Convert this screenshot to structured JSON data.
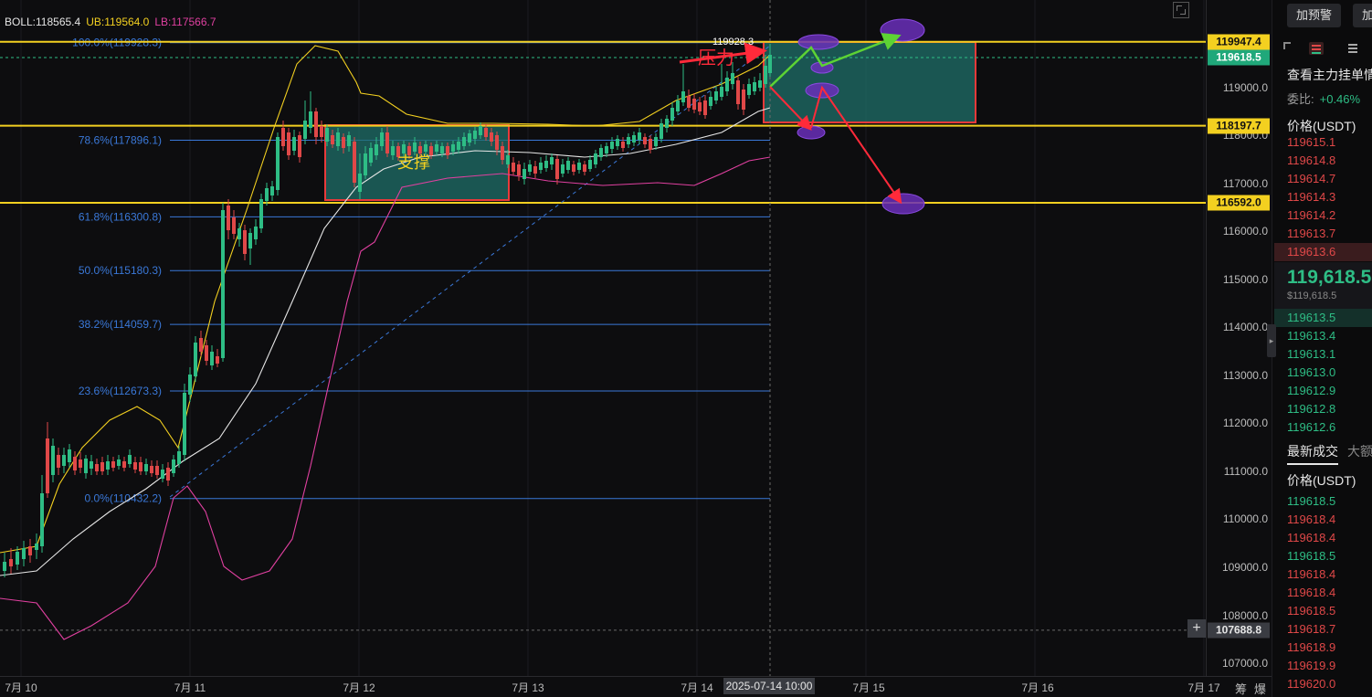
{
  "chart": {
    "boll": {
      "main_label": "BOLL:118565.4",
      "ub_label": "UB:119564.0",
      "lb_label": "LB:117566.7",
      "main_color": "#e6e6e6",
      "ub_color": "#f3d020",
      "lb_color": "#e040a0"
    },
    "fib_levels": [
      {
        "label": "100.0%(119928.3)",
        "price": 119928.3
      },
      {
        "label": "78.6%(117896.1)",
        "price": 117896.1
      },
      {
        "label": "61.8%(116300.8)",
        "price": 116300.8
      },
      {
        "label": "50.0%(115180.3)",
        "price": 115180.3
      },
      {
        "label": "38.2%(114059.7)",
        "price": 114059.7
      },
      {
        "label": "23.6%(112673.3)",
        "price": 112673.3
      },
      {
        "label": "0.0%(110432.2)",
        "price": 110432.2
      }
    ],
    "horizontal_levels": [
      119947.4,
      118197.7,
      116592.0
    ],
    "current_price_line": 119618.5,
    "crosshair_price": 107688.8,
    "high_marker": "119928.3",
    "support_label": "支撑",
    "pressure_label": "压力",
    "colors": {
      "up": "#2ebd85",
      "down": "#e04848",
      "fib": "#3a78d8",
      "level": "#f3d020",
      "zone_fill": "#1f6f6a",
      "zone_border": "#e83a3a",
      "arrow_red": "#ff2a3a",
      "arrow_green": "#5dd334",
      "ellipse": "#6a2fb8"
    }
  },
  "price_axis": {
    "ticks": [
      "119000.0",
      "118000.0",
      "117000.0",
      "116000.0",
      "115000.0",
      "114000.0",
      "113000.0",
      "112000.0",
      "111000.0",
      "110000.0",
      "109000.0",
      "108000.0",
      "107000.0"
    ],
    "badges": [
      {
        "text": "119947.4",
        "style": "yellow"
      },
      {
        "text": "119618.5",
        "style": "green"
      },
      {
        "text": "118197.7",
        "style": "yellow"
      },
      {
        "text": "116592.0",
        "style": "yellow"
      },
      {
        "text": "107688.8",
        "style": "gray"
      }
    ]
  },
  "time_axis": {
    "ticks": [
      "7月 10",
      "7月 11",
      "7月 12",
      "7月 13",
      "7月 14",
      "7月 15",
      "7月 16",
      "7月 17"
    ],
    "crosshair_time": "2025-07-14 10:00",
    "btn_chou": "筹",
    "btn_bao": "爆"
  },
  "side_panel": {
    "add_alert_btn": "加预警",
    "add_btn2": "加",
    "title": "查看主力挂单情",
    "wei_label": "委比:",
    "wei_value": "+0.46%",
    "price_header": "价格(USDT)",
    "asks": [
      "119615.1",
      "119614.8",
      "119614.7",
      "119614.3",
      "119614.2",
      "119613.7",
      "119613.6"
    ],
    "last_price": "119,618.5",
    "last_price_sub": "$119,618.5",
    "bids": [
      "119613.5",
      "119613.4",
      "119613.1",
      "119613.0",
      "119612.9",
      "119612.8",
      "119612.6"
    ],
    "tab_trades": "最新成交",
    "tab_big": "大额",
    "trades_header": "价格(USDT)",
    "trades": [
      {
        "price": "119618.5",
        "side": "buy"
      },
      {
        "price": "119618.4",
        "side": "sell"
      },
      {
        "price": "119618.4",
        "side": "sell"
      },
      {
        "price": "119618.5",
        "side": "buy"
      },
      {
        "price": "119618.4",
        "side": "sell"
      },
      {
        "price": "119618.4",
        "side": "sell"
      },
      {
        "price": "119618.5",
        "side": "sell"
      },
      {
        "price": "119618.7",
        "side": "sell"
      },
      {
        "price": "119618.9",
        "side": "sell"
      },
      {
        "price": "119619.9",
        "side": "sell"
      },
      {
        "price": "119620.0",
        "side": "sell"
      }
    ]
  }
}
